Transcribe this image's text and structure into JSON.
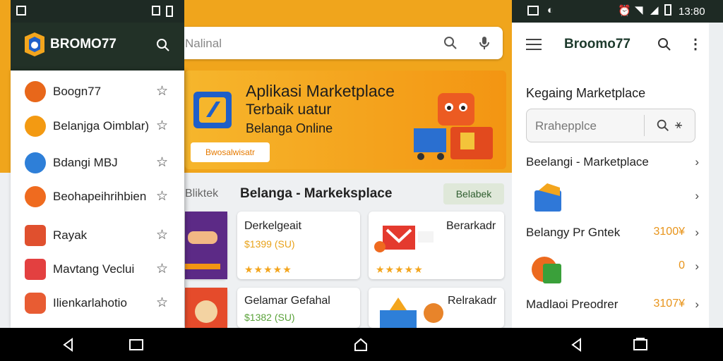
{
  "main": {
    "search": {
      "placeholder": "Nalinal"
    },
    "banner": {
      "line1": "Aplikasi Marketplace",
      "line2": "Terbaik uatur",
      "line3": "Belanga Online",
      "button": "Bwosalwisatr"
    },
    "section": {
      "prev_label": "Bliktek",
      "title": "Belanga - Markeksplace",
      "button": "Belabek"
    },
    "cards": [
      {
        "name": "Derkelgeait",
        "price": "$1399 (SU)",
        "stars": "★★★★★"
      },
      {
        "name": "Berarkadr",
        "price": "",
        "stars": "★★★★★"
      },
      {
        "name": "Gelamar Gefahal",
        "price": "$1382 (SU)",
        "stars": ""
      },
      {
        "name": "Relrakadr",
        "price": "",
        "stars": ""
      }
    ]
  },
  "drawer": {
    "logo": "BROMO77",
    "items": [
      {
        "label": "Boogn77",
        "color": "#e8671a"
      },
      {
        "label": "Belanjga Oimblar)",
        "color": "#f39a12"
      },
      {
        "label": "Bdangi MBJ",
        "color": "#2e7fd8"
      },
      {
        "label": "Beohapeihrihbien",
        "color": "#ef6b1f"
      },
      {
        "label": "Rayak",
        "color": "#e0502e"
      },
      {
        "label": "Mavtang Veclui",
        "color": "#e34040"
      },
      {
        "label": "Ilienkarlahotio",
        "color": "#e85c33"
      }
    ]
  },
  "right": {
    "status_time": "13:80",
    "app_title": "Broomo77",
    "section_title": "Kegaing Marketplace",
    "search_placeholder": "Rrahepplce",
    "rows": [
      {
        "label": "Beelangi - Marketplace",
        "price": ""
      },
      {
        "label": "",
        "price": ""
      },
      {
        "label": "Belangy Pr Gntek",
        "price": "3100¥"
      },
      {
        "label": "",
        "price": "0"
      },
      {
        "label": "Madlaoi Preodrer",
        "price": "3107¥"
      }
    ]
  },
  "colors": {
    "accent": "#f0a51c",
    "dark": "#223127",
    "price": "#e8941a"
  }
}
